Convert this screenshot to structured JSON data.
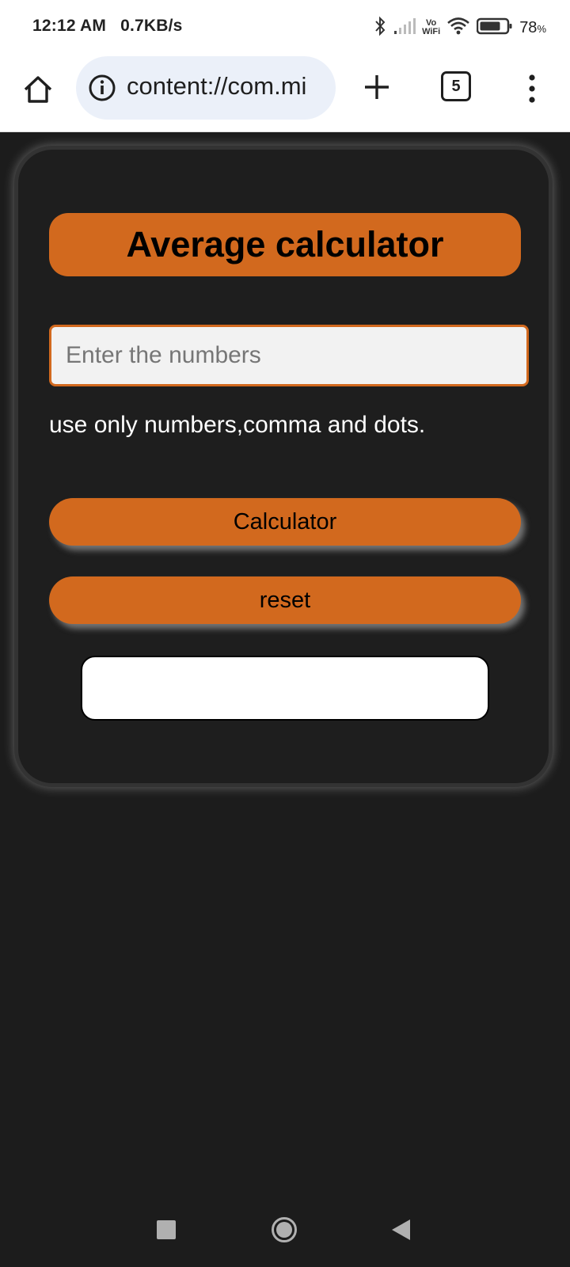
{
  "status_bar": {
    "time": "12:12 AM",
    "network_speed": "0.7KB/s",
    "volte_top": "Vo",
    "volte_bottom": "WiFi",
    "battery_value": "78",
    "battery_unit": "%",
    "battery_level": 0.78
  },
  "browser": {
    "url": "content://com.mi",
    "tab_count": "5"
  },
  "app": {
    "title": "Average calculator",
    "input_placeholder": "Enter the numbers",
    "input_value": "",
    "hint": "use only numbers,comma and dots.",
    "calculate_label": "Calculator",
    "reset_label": "reset",
    "result": ""
  },
  "colors": {
    "accent": "#d2691e",
    "card_background": "#1e1e1e",
    "page_background": "#1c1c1c"
  }
}
